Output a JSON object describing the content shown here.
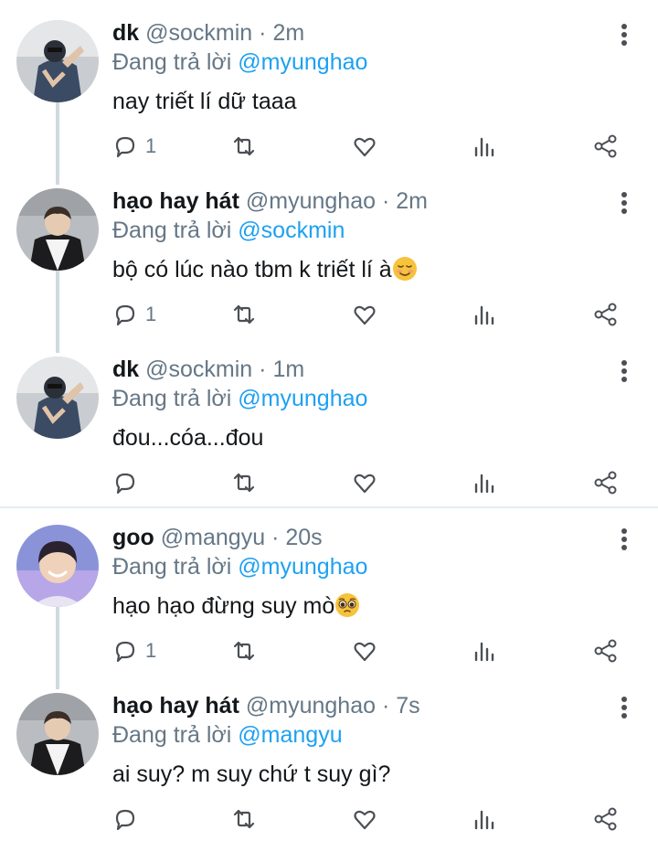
{
  "tweets": [
    {
      "display_name": "dk",
      "handle": "@sockmin",
      "separator": "·",
      "time": "2m",
      "reply_prefix": "Đang trả lời",
      "reply_to": "@myunghao",
      "text": "nay triết lí dữ taaa",
      "reply_count": "1",
      "avatar": "avatar-dk"
    },
    {
      "display_name": "hạo hay hát",
      "handle": "@myunghao",
      "separator": "·",
      "time": "2m",
      "reply_prefix": "Đang trả lời",
      "reply_to": "@sockmin",
      "text": "bộ có lúc nào tbm k triết lí à",
      "emoji": "relieved-face-emoji",
      "reply_count": "1",
      "avatar": "avatar-hao"
    },
    {
      "display_name": "dk",
      "handle": "@sockmin",
      "separator": "·",
      "time": "1m",
      "reply_prefix": "Đang trả lời",
      "reply_to": "@myunghao",
      "text": "đou...cóa...đou",
      "reply_count": "",
      "avatar": "avatar-dk"
    },
    {
      "display_name": "goo",
      "handle": "@mangyu",
      "separator": "·",
      "time": "20s",
      "reply_prefix": "Đang trả lời",
      "reply_to": "@myunghao",
      "text": "hạo hạo đừng suy mò",
      "emoji": "pleading-face-emoji",
      "reply_count": "1",
      "avatar": "avatar-goo"
    },
    {
      "display_name": "hạo hay hát",
      "handle": "@myunghao",
      "separator": "·",
      "time": "7s",
      "reply_prefix": "Đang trả lời",
      "reply_to": "@mangyu",
      "text": "ai suy? m suy chứ t suy gì?",
      "reply_count": "",
      "avatar": "avatar-hao"
    }
  ],
  "icons": {
    "reply": "reply-icon",
    "retweet": "retweet-icon",
    "like": "like-icon",
    "views": "views-icon",
    "share": "share-icon",
    "more": "more-options-icon"
  },
  "colors": {
    "text": "#14171a",
    "secondary": "#657786",
    "mention": "#1da1f2",
    "thread_line": "#cfd9de",
    "separator": "#e6ecf0"
  }
}
